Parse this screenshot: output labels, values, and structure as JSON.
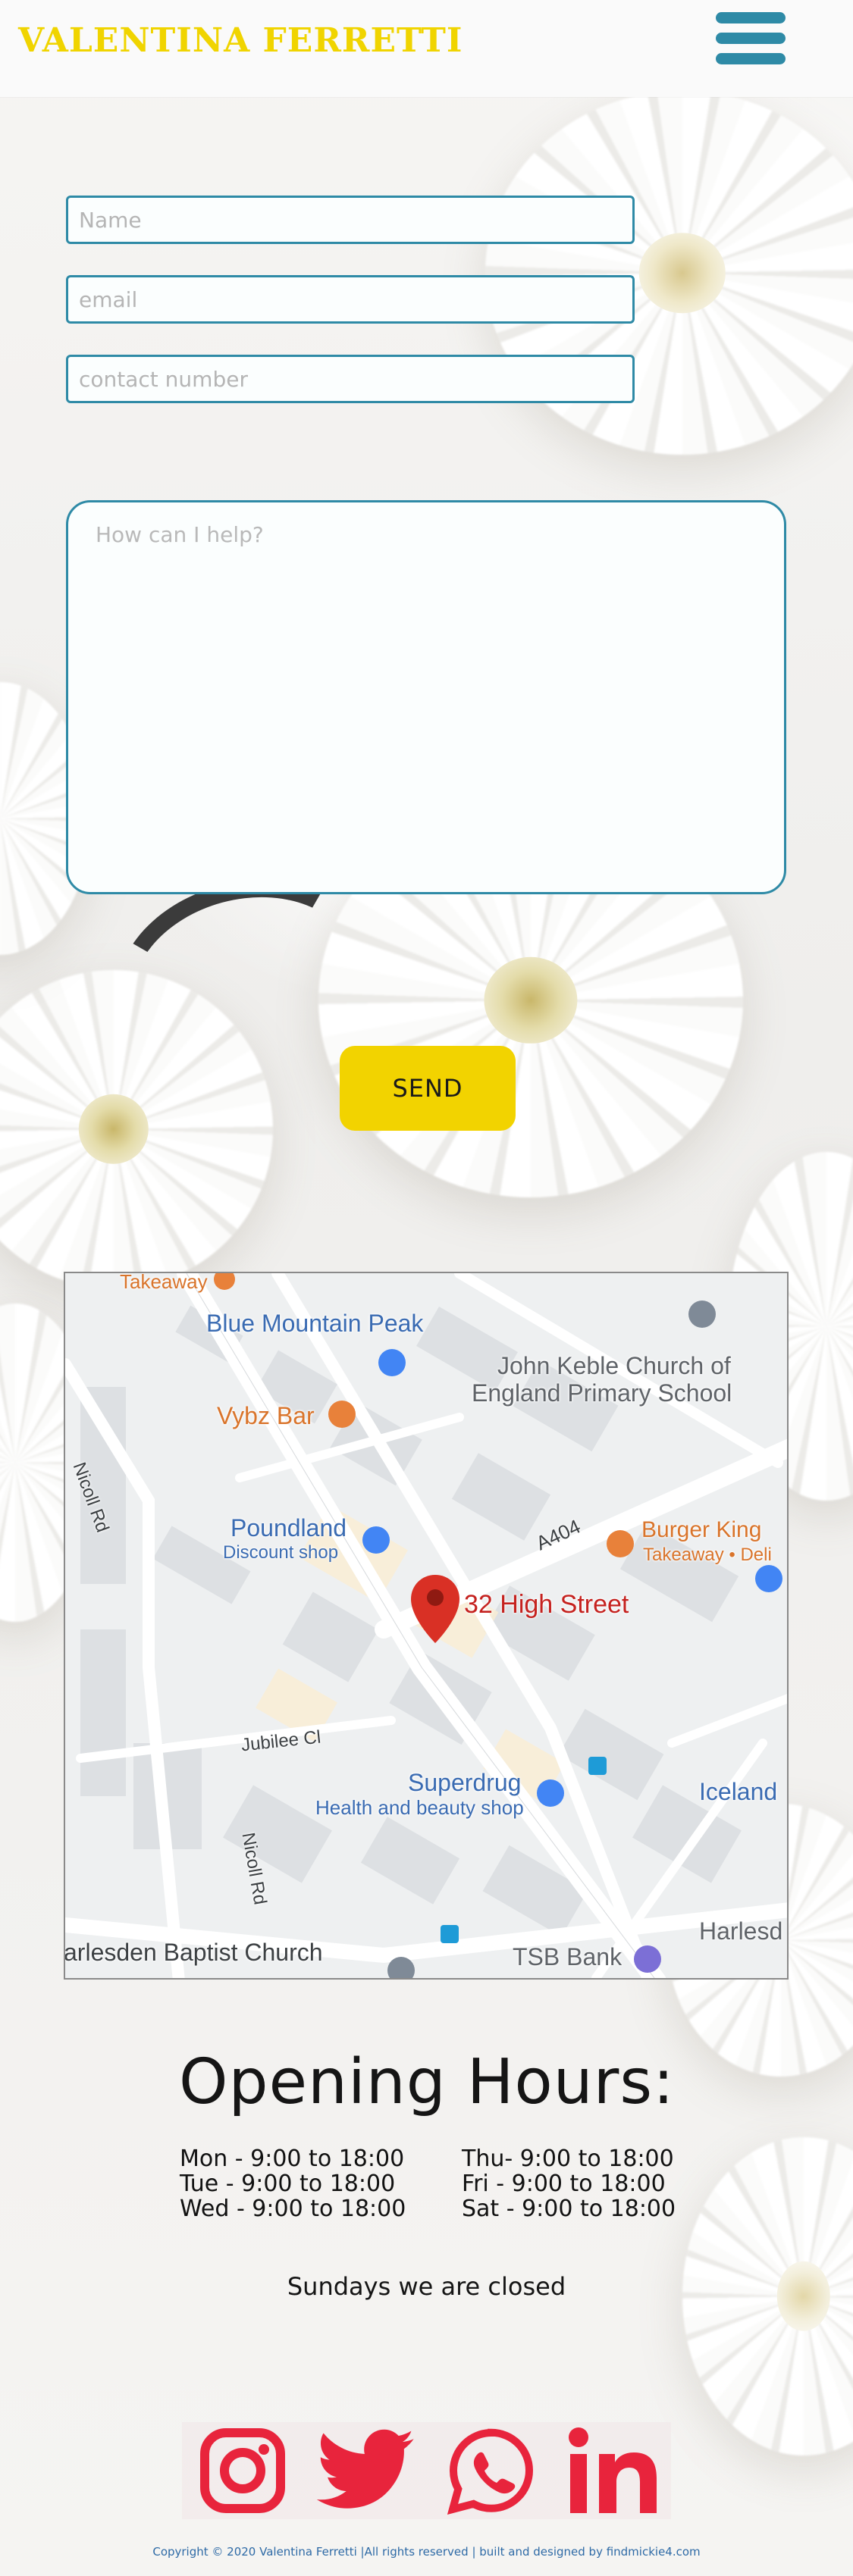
{
  "header": {
    "brand": "VALENTINA FERRETTI",
    "menu_icon": "hamburger-menu-icon"
  },
  "form": {
    "name_placeholder": "Name",
    "email_placeholder": "email",
    "phone_placeholder": "contact number",
    "message_placeholder": "How can I help?",
    "send_label": "SEND"
  },
  "map": {
    "pin_label": "32 High Street",
    "places": {
      "takeaway_top": "Takeaway",
      "blue_mountain": "Blue Mountain Peak",
      "keble_1": "John Keble Church of",
      "keble_2": "England Primary School",
      "vybz": "Vybz Bar",
      "poundland": "Poundland",
      "poundland_sub": "Discount shop",
      "burger_king": "Burger King",
      "burger_king_sub": "Takeaway • Deli",
      "a404": "A404",
      "nicoll_rd_top": "Nicoll Rd",
      "jubilee": "Jubilee Cl",
      "nicoll_rd_bottom": "Nicoll Rd",
      "superdrug": "Superdrug",
      "superdrug_sub": "Health and beauty shop",
      "iceland": "Iceland",
      "baptist": "arlesden Baptist Church",
      "tsb": "TSB Bank",
      "harlesden": "Harlesd"
    },
    "colors": {
      "pin": "#d93025",
      "blue_poi": "#4285f4",
      "orange_poi": "#e8813a"
    }
  },
  "hours": {
    "title": "Opening Hours:",
    "left": [
      "Mon - 9:00 to 18:00",
      "Tue - 9:00 to 18:00",
      "Wed - 9:00 to 18:00"
    ],
    "right": [
      "Thu- 9:00 to 18:00",
      "Fri - 9:00 to 18:00",
      "Sat - 9:00 to 18:00"
    ],
    "closed": "Sundays we are closed"
  },
  "social": {
    "icons": [
      "instagram-icon",
      "twitter-icon",
      "whatsapp-icon",
      "linkedin-icon"
    ],
    "color": "#e8243c"
  },
  "footer": {
    "text": "Copyright © 2020 Valentina Ferretti |All rights reserved | built and designed by findmickie4.com"
  },
  "colors": {
    "brand": "#f0d400",
    "accent": "#2e8aa6",
    "button": "#f2d300"
  }
}
